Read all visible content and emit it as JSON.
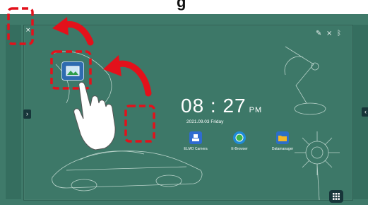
{
  "page": {
    "title": "g"
  },
  "board": {
    "close_glyph": "×",
    "close_icon": "close-icon",
    "left_arrow": "›",
    "right_arrow": "‹",
    "status_icons": [
      "pen-icon",
      "wifi-off-icon",
      "bluetooth-icon"
    ]
  },
  "clock": {
    "time": "08 : 27",
    "ampm": "PM",
    "date": "2021.09.03  Friday"
  },
  "apps": [
    {
      "label": "ELMO Camera",
      "icon": "usb-camera-icon",
      "color": "#2f6bd1"
    },
    {
      "label": "E-Browser",
      "icon": "globe-icon",
      "color": "#1f8bd8"
    },
    {
      "label": "Datamanager",
      "icon": "folder-icon",
      "color": "#2c6fc7"
    }
  ],
  "gallery_icon": "gallery-icon",
  "grid_icon": "app-grid-icon",
  "annotation_color": "#e3111b"
}
